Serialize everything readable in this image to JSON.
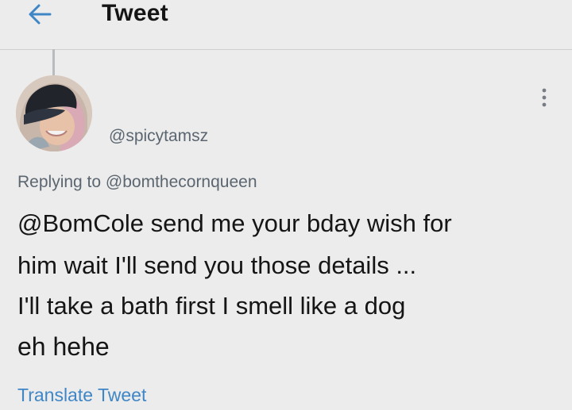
{
  "header": {
    "title": "Tweet",
    "back_icon": "arrow-left-icon"
  },
  "tweet": {
    "handle": "@spicytamsz",
    "replying_to": "Replying to @bomthecornqueen",
    "lines": [
      "@BomCole send me your bday wish for",
      "him wait I'll send you those details ...",
      "I'll take a bath first I smell like a dog",
      "eh hehe"
    ],
    "translate_label": "Translate Tweet",
    "more_icon": "more-vertical-icon"
  },
  "colors": {
    "background": "#ececec",
    "accent": "#3f86c6",
    "secondary_text": "#5b6670",
    "divider": "#cfcfcf"
  }
}
